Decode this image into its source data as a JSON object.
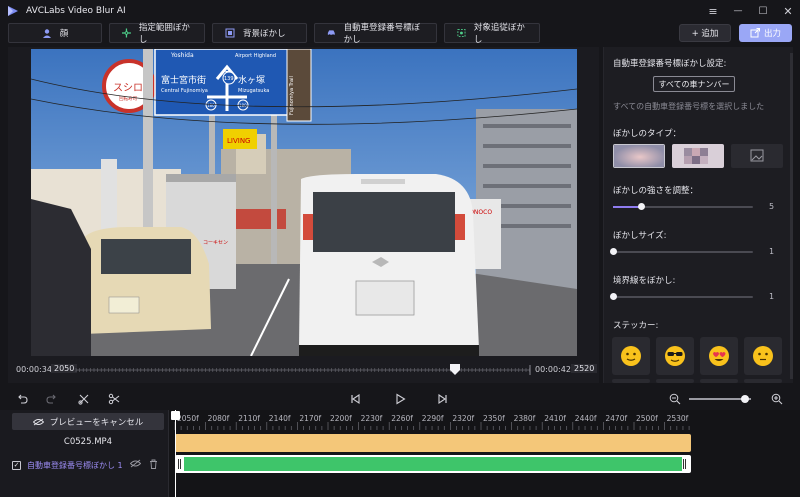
{
  "app": {
    "title": "AVCLabs Video Blur AI"
  },
  "window_controls": {
    "menu": "≡",
    "minimize": "—",
    "maximize": "☐",
    "close": "✕"
  },
  "tabs": [
    {
      "label": "顔"
    },
    {
      "label": "指定範囲ぼかし"
    },
    {
      "label": "背景ぼかし"
    },
    {
      "label": "自動車登録番号標ぼかし"
    },
    {
      "label": "対象追従ぼかし"
    }
  ],
  "toolbar": {
    "add_label": "+ 追加",
    "output_label": "出力"
  },
  "preview": {
    "start_time": "00:00:34",
    "start_frame": "2050",
    "end_time": "00:00:42",
    "end_frame": "2520",
    "scrub_position": 0.835,
    "signs": {
      "left_top": "Yoshida",
      "left_city_jp": "富士宮市街",
      "left_city_en": "Central Fujinomiya",
      "right_top": "Airport Highland",
      "right_city_jp": "水ヶ塚",
      "right_city_en": "Mizugatsuka",
      "route_number": "139",
      "route_lower": "180",
      "side_sign": "Fujinomiya Trail",
      "vertical_sign": "富士宮口五合目",
      "shop_sign": "スシロー",
      "shop_sub": "回転寿司",
      "store_sign": "LIVING",
      "grey_truck": "コーキセン",
      "white_building": "CONOCO"
    }
  },
  "panel": {
    "section_title": "自動車登録番号標ぼかし設定:",
    "all_plates_button": "すべての車ナンバー",
    "all_plates_note": "すべての自動車登録番号標を選択しました",
    "blur_type_label": "ぼかしのタイプ：",
    "strength_label": "ぼかしの強さを調整：",
    "strength_value": "5",
    "strength_fraction": 0.2,
    "size_label": "ぼかしサイズ:",
    "size_value": "1",
    "size_fraction": 0.0,
    "edge_label": "境界線をぼかし:",
    "edge_value": "1",
    "edge_fraction": 0.0,
    "sticker_label": "ステッカー:",
    "stickers": [
      "slightly-smiling-face",
      "smiling-face-with-sunglasses",
      "heart-eyes-face",
      "neutral-face"
    ]
  },
  "timeline": {
    "cancel_preview": "プレビューをキャンセル",
    "clip_name": "C0525.MP4",
    "track_label": "自動車登録番号標ぼかし 1",
    "track_checked": "✓",
    "zoom_fraction": 0.9,
    "ruler": [
      "2050f",
      "2080f",
      "2110f",
      "2140f",
      "2170f",
      "2200f",
      "2230f",
      "2260f",
      "2290f",
      "2320f",
      "2350f",
      "2380f",
      "2410f",
      "2440f",
      "2470f",
      "2500f",
      "2530f"
    ]
  },
  "colors": {
    "accent": "#9aa7f6",
    "track_label": "#9d8df5",
    "clip_bar": "#f4c779",
    "blur_bar": "#3ec56a",
    "slider_fill": "#8f7cf0"
  }
}
